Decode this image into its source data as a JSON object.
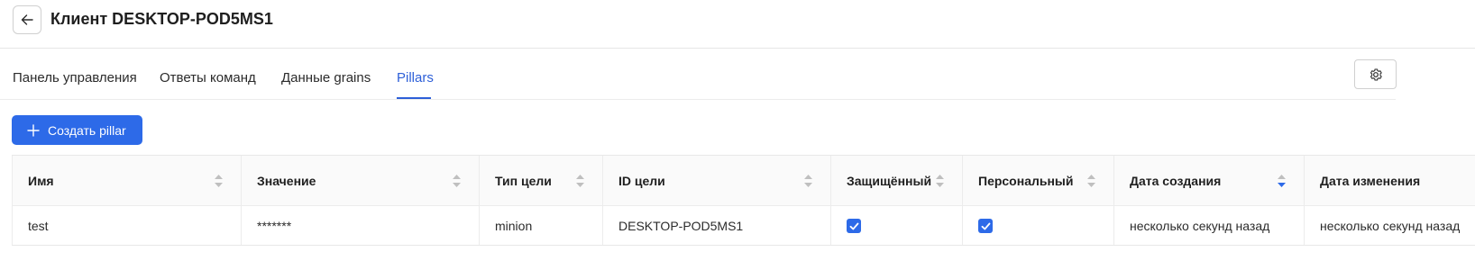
{
  "header": {
    "title": "Клиент DESKTOP-POD5MS1",
    "back_icon": "arrow-left-icon"
  },
  "tabs": [
    {
      "label": "Панель управления",
      "active": false
    },
    {
      "label": "Ответы команд",
      "active": false
    },
    {
      "label": "Данные grains",
      "active": false
    },
    {
      "label": "Pillars",
      "active": true
    }
  ],
  "settings_icon": "gear-icon",
  "toolbar": {
    "create_label": "Создать pillar"
  },
  "table": {
    "columns": [
      {
        "label": "Имя",
        "sort": "none"
      },
      {
        "label": "Значение",
        "sort": "none"
      },
      {
        "label": "Тип цели",
        "sort": "none"
      },
      {
        "label": "ID цели",
        "sort": "none"
      },
      {
        "label": "Защищённый",
        "sort": "none"
      },
      {
        "label": "Персональный",
        "sort": "none"
      },
      {
        "label": "Дата создания",
        "sort": "descending"
      },
      {
        "label": "Дата изменения",
        "sort": "none"
      }
    ],
    "rows": [
      {
        "name": "test",
        "value": "*******",
        "target_type": "minion",
        "target_id": "DESKTOP-POD5MS1",
        "protected": true,
        "personal": true,
        "created": "несколько секунд назад",
        "modified": "несколько секунд назад"
      }
    ]
  },
  "colors": {
    "accent": "#2d6ae8",
    "active_tab": "#2d5fd8"
  }
}
